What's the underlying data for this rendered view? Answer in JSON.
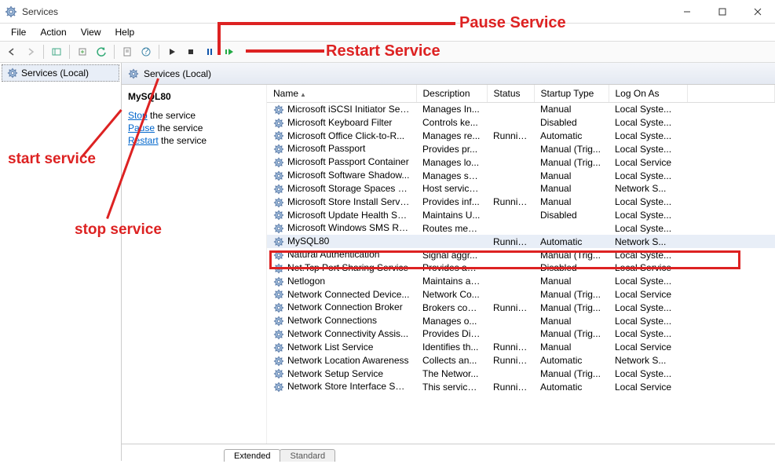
{
  "window": {
    "title": "Services"
  },
  "menu": {
    "file": "File",
    "action": "Action",
    "view": "View",
    "help": "Help"
  },
  "tree": {
    "root": "Services (Local)"
  },
  "detailHeader": "Services (Local)",
  "actionPanel": {
    "selected": "MySQL80",
    "stopPrefix": "Stop",
    "stopSuffix": " the service",
    "pausePrefix": "Pause",
    "pauseSuffix": " the service",
    "restartPrefix": "Restart",
    "restartSuffix": " the service"
  },
  "columns": {
    "name": "Name",
    "desc": "Description",
    "status": "Status",
    "startup": "Startup Type",
    "logon": "Log On As"
  },
  "tabs": {
    "extended": "Extended",
    "standard": "Standard"
  },
  "annotations": {
    "pause": "Pause Service",
    "restart": "Restart Service",
    "start": "start service",
    "stop": "stop service"
  },
  "services": [
    {
      "name": "Microsoft iSCSI Initiator Ser...",
      "desc": "Manages In...",
      "status": "",
      "startup": "Manual",
      "logon": "Local Syste..."
    },
    {
      "name": "Microsoft Keyboard Filter",
      "desc": "Controls ke...",
      "status": "",
      "startup": "Disabled",
      "logon": "Local Syste..."
    },
    {
      "name": "Microsoft Office Click-to-R...",
      "desc": "Manages re...",
      "status": "Running",
      "startup": "Automatic",
      "logon": "Local Syste..."
    },
    {
      "name": "Microsoft Passport",
      "desc": "Provides pr...",
      "status": "",
      "startup": "Manual (Trig...",
      "logon": "Local Syste..."
    },
    {
      "name": "Microsoft Passport Container",
      "desc": "Manages lo...",
      "status": "",
      "startup": "Manual (Trig...",
      "logon": "Local Service"
    },
    {
      "name": "Microsoft Software Shadow...",
      "desc": "Manages so...",
      "status": "",
      "startup": "Manual",
      "logon": "Local Syste..."
    },
    {
      "name": "Microsoft Storage Spaces S...",
      "desc": "Host service...",
      "status": "",
      "startup": "Manual",
      "logon": "Network S..."
    },
    {
      "name": "Microsoft Store Install Service",
      "desc": "Provides inf...",
      "status": "Running",
      "startup": "Manual",
      "logon": "Local Syste..."
    },
    {
      "name": "Microsoft Update Health Se...",
      "desc": "Maintains U...",
      "status": "",
      "startup": "Disabled",
      "logon": "Local Syste..."
    },
    {
      "name": "Microsoft Windows SMS Ro...",
      "desc": "Routes mes...",
      "status": "",
      "startup": "",
      "logon": "Local Syste..."
    },
    {
      "name": "MySQL80",
      "desc": "",
      "status": "Running",
      "startup": "Automatic",
      "logon": "Network S...",
      "selected": true
    },
    {
      "name": "Natural Authentication",
      "desc": "Signal aggr...",
      "status": "",
      "startup": "Manual (Trig...",
      "logon": "Local Syste..."
    },
    {
      "name": "Net.Tcp Port Sharing Service",
      "desc": "Provides abi...",
      "status": "",
      "startup": "Disabled",
      "logon": "Local Service"
    },
    {
      "name": "Netlogon",
      "desc": "Maintains a ...",
      "status": "",
      "startup": "Manual",
      "logon": "Local Syste..."
    },
    {
      "name": "Network Connected Device...",
      "desc": "Network Co...",
      "status": "",
      "startup": "Manual (Trig...",
      "logon": "Local Service"
    },
    {
      "name": "Network Connection Broker",
      "desc": "Brokers con...",
      "status": "Running",
      "startup": "Manual (Trig...",
      "logon": "Local Syste..."
    },
    {
      "name": "Network Connections",
      "desc": "Manages o...",
      "status": "",
      "startup": "Manual",
      "logon": "Local Syste..."
    },
    {
      "name": "Network Connectivity Assis...",
      "desc": "Provides Dir...",
      "status": "",
      "startup": "Manual (Trig...",
      "logon": "Local Syste..."
    },
    {
      "name": "Network List Service",
      "desc": "Identifies th...",
      "status": "Running",
      "startup": "Manual",
      "logon": "Local Service"
    },
    {
      "name": "Network Location Awareness",
      "desc": "Collects an...",
      "status": "Running",
      "startup": "Automatic",
      "logon": "Network S..."
    },
    {
      "name": "Network Setup Service",
      "desc": "The Networ...",
      "status": "",
      "startup": "Manual (Trig...",
      "logon": "Local Syste..."
    },
    {
      "name": "Network Store Interface Ser...",
      "desc": "This service ...",
      "status": "Running",
      "startup": "Automatic",
      "logon": "Local Service"
    }
  ]
}
